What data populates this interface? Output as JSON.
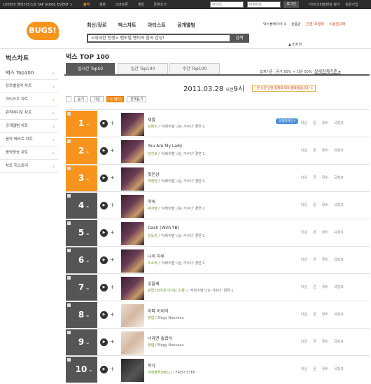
{
  "topbar": {
    "promo": "100만의 플레이리스트 TAP SONIC EVENT >",
    "nav": [
      "음악",
      "영화",
      "스마트폰",
      "게임",
      "콘텐츠기"
    ],
    "id_placeholder": "아이디",
    "pw_placeholder": "비밀번호",
    "login_label": "로그인",
    "links": [
      "아이디/비밀번호 찾기",
      "회원가입"
    ]
  },
  "header": {
    "logo": "BUGS!",
    "nav": [
      "최신/장르",
      "벅스차트",
      "아티스트",
      "공개앨범"
    ],
    "search_value": "<위대한 탄생> 멘토별 멘티의 음곡 감상!",
    "search_button": "검색",
    "right_links": [
      "벅스플레이어 4",
      "상품관",
      "간편 ID결제",
      "이용권구매"
    ],
    "right_sub": "▲ 비지언"
  },
  "sidebar": {
    "title": "벅스차트",
    "items": [
      "벅스 Top100",
      "장르별음악 차트",
      "아티스트 차트",
      "뮤직비디오 차트",
      "공개앨범 차트",
      "음악 베스트 차트",
      "음악방송 차트",
      "차트 히스토리"
    ]
  },
  "main": {
    "page_title": "벅스 TOP 100",
    "tabs": [
      "실시간 Top50",
      "일간 Top100",
      "주간 Top100"
    ],
    "criteria": "· 집계기준 : 듣기 50% + 다운 50%",
    "criteria_link": "상세집계기준 ▸",
    "date": "2011.03.28",
    "time_prefix": "오전",
    "time": "9시",
    "note": "· 한 시간 단위 집계로 더욱 빨라졌습니다! ×",
    "controls": [
      "듣기",
      "다운",
      "+ 담기",
      "전체듣기"
    ]
  },
  "chart_rows": [
    {
      "rank": "1",
      "title": "제발",
      "artist": "김범수",
      "album": "'서바이벌 나는 가수다' 경연 1",
      "hot": true
    },
    {
      "rank": "2",
      "title": "You Are My Lady",
      "artist": "김건모",
      "album": "'서바이벌 나는 가수다' 경연 1",
      "hot": true
    },
    {
      "rank": "3",
      "title": "첫인상",
      "artist": "박정현",
      "album": "'서바이벌 나는 가수다' 경연 1",
      "hot": true
    },
    {
      "rank": "4",
      "title": "약속",
      "artist": "박지영",
      "album": "'서바이벌 나는 가수다' 경연 1",
      "hot": false
    },
    {
      "rank": "5",
      "title": "Dash (With YB)",
      "artist": "윤도현",
      "album": "'서바이벌 나는 가수다' 경연 1",
      "hot": false
    },
    {
      "rank": "6",
      "title": "나의 하루",
      "artist": "이소라",
      "album": "'서바이벌 나는 가수다' 경연 1",
      "hot": false
    },
    {
      "rank": "7",
      "title": "잊을께",
      "artist": "정엽 (브라운 아이드 소울)",
      "album": "'서바이벌 나는 가수다' 경연 1",
      "hot": false
    },
    {
      "rank": "8",
      "title": "아파 아이야",
      "artist": "정엽",
      "album": "Elegy Nouveau",
      "hot": false
    },
    {
      "rank": "9",
      "title": "너라면 좋겠어",
      "artist": "정엽",
      "album": "Elegy Nouveau",
      "hot": false
    },
    {
      "rank": "10",
      "title": "착각",
      "artist": "피엔블루(NELL)",
      "album": "FIRST STEP",
      "hot": false
    }
  ],
  "row_actions": [
    "다운",
    "폰",
    "뮤비",
    "곡정보"
  ],
  "badge": "뮤플라이인↑",
  "colors": {
    "accent": "#f7941d",
    "dark_tab": "#5a5a5a"
  }
}
